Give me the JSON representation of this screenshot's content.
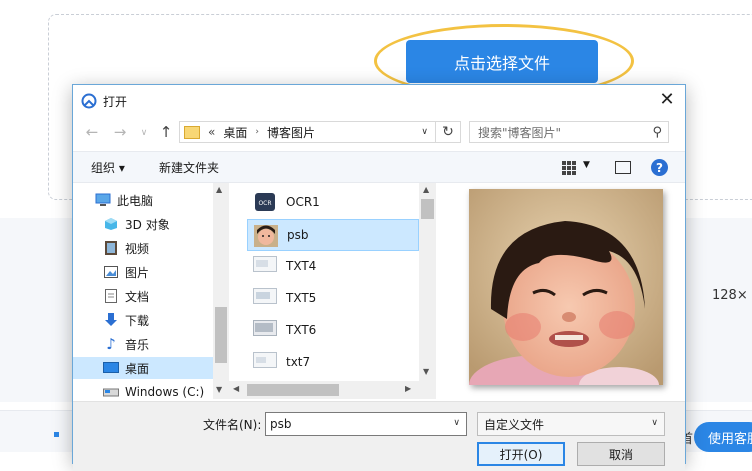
{
  "background": {
    "select_file_button": "点击选择文件",
    "size_text": "128×",
    "partial_text": "首",
    "use_button": "使用客服"
  },
  "dialog": {
    "title": "打开",
    "address": {
      "prefix": "«",
      "segments": [
        "桌面",
        "博客图片"
      ]
    },
    "search_placeholder": "搜索\"博客图片\"",
    "toolbar": {
      "organize": "组织 ▾",
      "new_folder": "新建文件夹"
    },
    "nav_items": [
      {
        "label": "此电脑",
        "icon": "computer-icon"
      },
      {
        "label": "3D 对象",
        "icon": "3d-objects-icon"
      },
      {
        "label": "视频",
        "icon": "video-icon"
      },
      {
        "label": "图片",
        "icon": "pictures-icon"
      },
      {
        "label": "文档",
        "icon": "documents-icon"
      },
      {
        "label": "下载",
        "icon": "download-icon"
      },
      {
        "label": "音乐",
        "icon": "music-icon"
      },
      {
        "label": "桌面",
        "icon": "desktop-icon",
        "selected": true
      },
      {
        "label": "Windows (C:)",
        "icon": "drive-icon"
      }
    ],
    "files": [
      {
        "name": "OCR1",
        "thumb": "ocr-thumb"
      },
      {
        "name": "psb",
        "thumb": "face-thumb",
        "selected": true
      },
      {
        "name": "TXT4",
        "thumb": "image-thumb"
      },
      {
        "name": "TXT5",
        "thumb": "image-thumb"
      },
      {
        "name": "TXT6",
        "thumb": "image-thumb"
      },
      {
        "name": "txt7",
        "thumb": "image-thumb"
      }
    ],
    "filename_label": "文件名(N):",
    "filename_value": "psb",
    "filetype_value": "自定义文件",
    "open_button": "打开(O)",
    "cancel_button": "取消"
  },
  "colors": {
    "accent": "#2b86e5",
    "highlight": "#f3c242",
    "selection": "#cce8ff"
  }
}
